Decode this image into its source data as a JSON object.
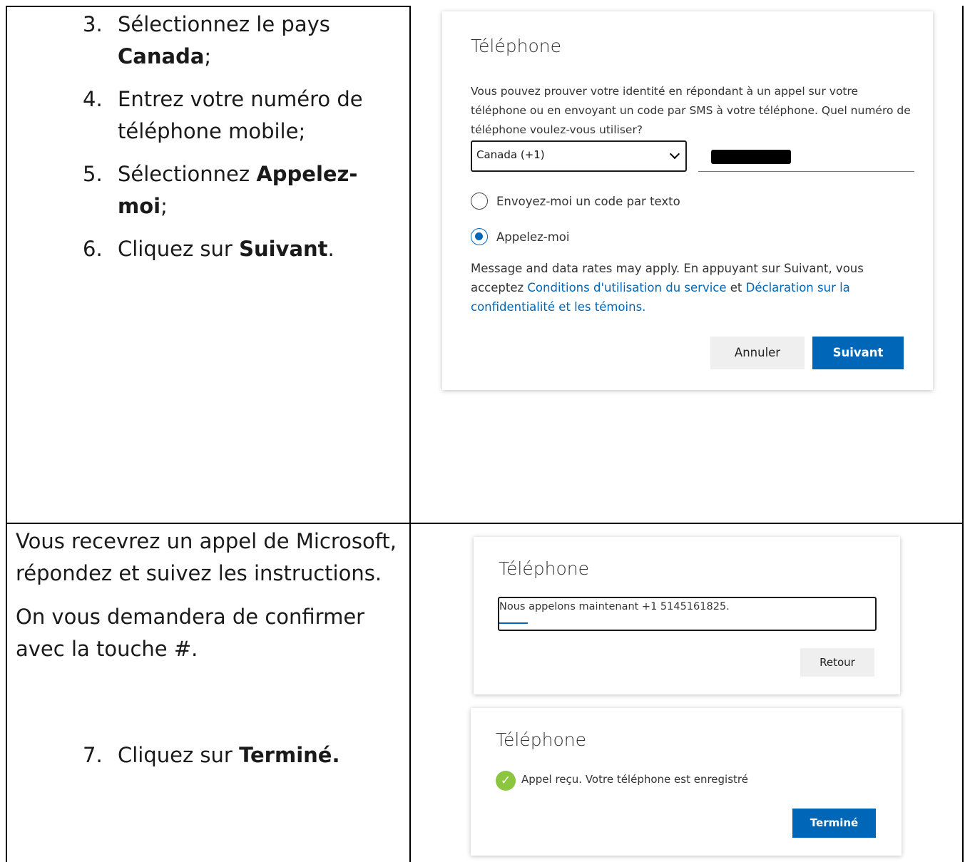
{
  "steps_top": [
    {
      "num": "3.",
      "pre": "Sélectionnez le pays ",
      "bold": "Canada",
      "post": ";"
    },
    {
      "num": "4.",
      "pre": "Entrez votre numéro de téléphone mobile;",
      "bold": "",
      "post": ""
    },
    {
      "num": "5.",
      "pre": "Sélectionnez ",
      "bold": "Appelez-moi",
      "post": ";"
    },
    {
      "num": "6.",
      "pre": "Cliquez sur ",
      "bold": "Suivant",
      "post": "."
    }
  ],
  "bottom_left": {
    "para1": "Vous recevrez un appel de Microsoft, répondez et suivez les instructions.",
    "para2": "On vous demandera de confirmer avec la touche #.",
    "step7": {
      "num": "7.",
      "pre": "Cliquez sur ",
      "bold": "Terminé."
    }
  },
  "card1": {
    "title": "Téléphone",
    "description": "Vous pouvez prouver votre identité en répondant à un appel sur votre téléphone ou en envoyant un code par SMS à votre téléphone. Quel numéro de téléphone voulez-vous utiliser?",
    "country_select": "Canada (+1)",
    "radio_text": "Envoyez-moi un code par texto",
    "radio_call": "Appelez-moi",
    "selected_option": "Appelez-moi",
    "legal_prefix": "Message and data rates may apply. En appuyant sur Suivant, vous acceptez ",
    "legal_link1": "Conditions d'utilisation du service",
    "legal_mid": " et ",
    "legal_link2": "Déclaration sur la confidentialité et les témoins.",
    "cancel_label": "Annuler",
    "next_label": "Suivant"
  },
  "card2": {
    "title": "Téléphone",
    "status": "Nous appelons maintenant +1 5145161825.",
    "back_label": "Retour"
  },
  "card3": {
    "title": "Téléphone",
    "success": "Appel reçu. Votre téléphone est enregistré",
    "done_label": "Terminé"
  },
  "colors": {
    "accent": "#0067b8",
    "success": "#8cc63f"
  }
}
